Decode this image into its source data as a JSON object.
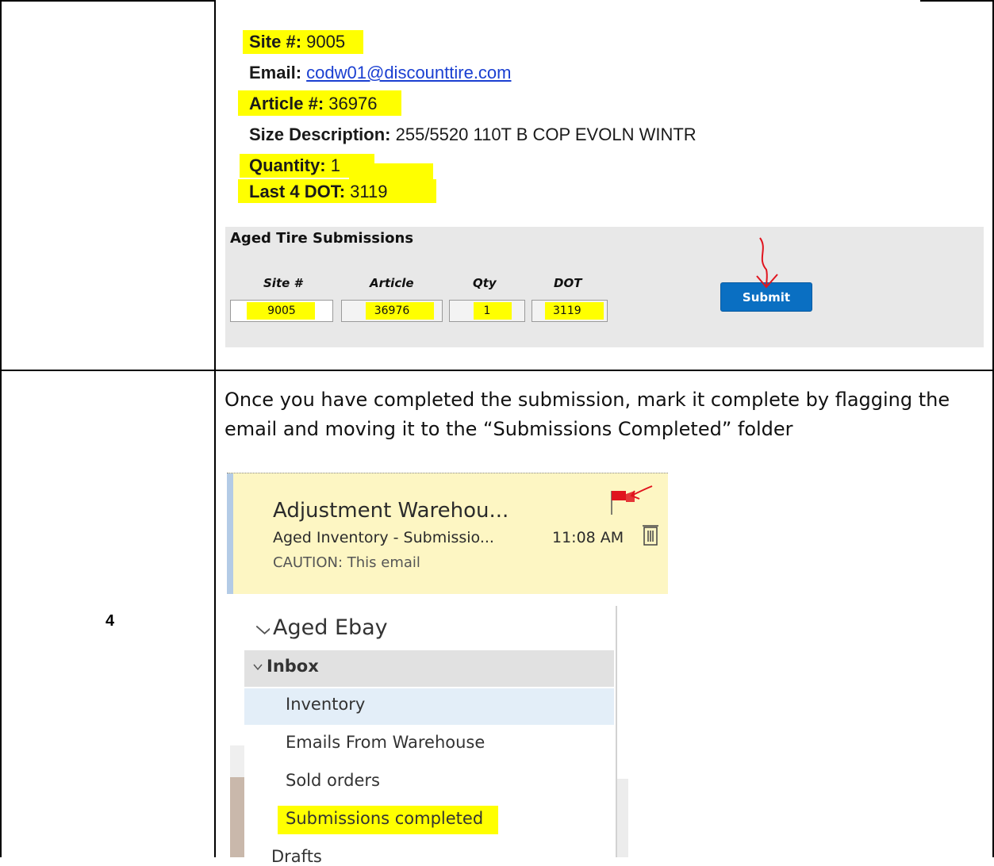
{
  "email_info": {
    "site_label": "Site #:",
    "site_value": "9005",
    "email_label": "Email:",
    "email_value": "codw01@discounttire.com",
    "article_label": "Article #:",
    "article_value": "36976",
    "size_label": "Size Description:",
    "size_value": "255/5520 110T B COP EVOLN WINTR",
    "quantity_label": "Quantity:",
    "quantity_value": "1",
    "dot_label": "Last 4 DOT:",
    "dot_value": "3119"
  },
  "form": {
    "title": "Aged Tire Submissions",
    "columns": [
      "Site #",
      "Article",
      "Qty",
      "DOT"
    ],
    "site_value": "9005",
    "article_value": "36976",
    "qty_value": "1",
    "dot_value": "3119",
    "submit_label": "Submit"
  },
  "row2": {
    "step_number": "4",
    "instruction": "Once you have completed the submission, mark it complete by flagging the email and moving it to the “Submissions Completed” folder"
  },
  "email_card": {
    "sender": "Adjustment Warehou...",
    "subject": "Aged Inventory - Submissio...",
    "preview": "CAUTION: This email",
    "time": "11:08 AM",
    "flag_icon": "flag-icon",
    "trash_icon": "trash-icon"
  },
  "folders": {
    "root": "Aged Ebay",
    "inbox": "Inbox",
    "items": [
      "Inventory",
      "Emails From Warehouse",
      "Sold orders",
      "Submissions completed"
    ],
    "next_partial": "Drafts"
  },
  "colors": {
    "highlight": "#ffff00",
    "submit": "#0a6fc2",
    "card_bg": "#fdf6c3",
    "annotation_red": "#e0141e"
  }
}
